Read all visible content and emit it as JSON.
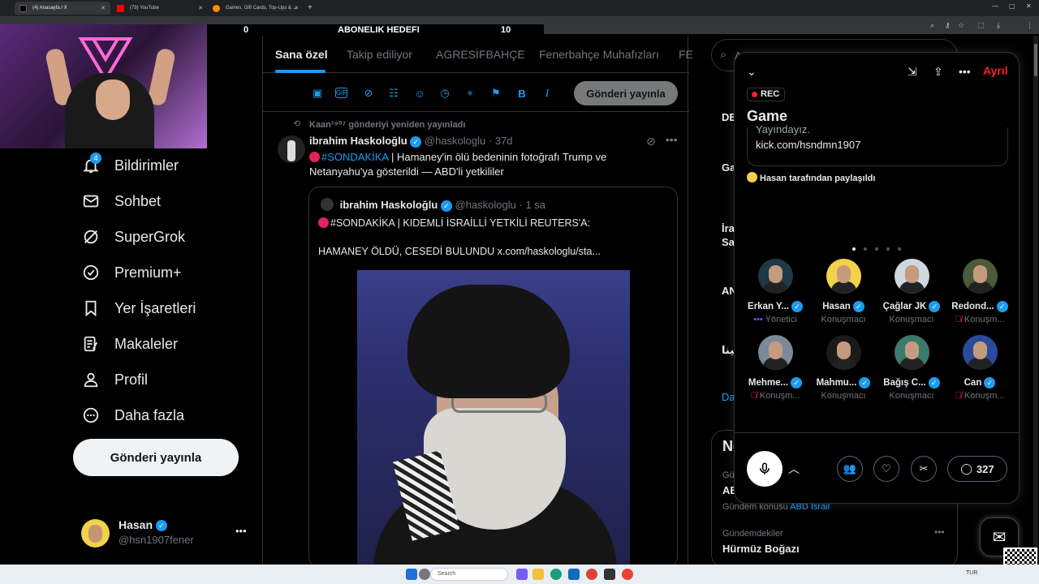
{
  "browser": {
    "tabs": [
      {
        "label": "(4) Anasayfa / X",
        "active": true
      },
      {
        "label": "(79) YouTube",
        "active": false
      },
      {
        "label": "Games, Gift Cards, Top-Ups & ...",
        "active": false
      }
    ]
  },
  "stream_overlay": {
    "left_value": "0",
    "goal_label": "ABONELIK HEDEFI",
    "right_value": "10"
  },
  "sidebar": {
    "items": [
      {
        "label": "Bildirimler",
        "icon": "bell-icon",
        "badge": "4"
      },
      {
        "label": "Sohbet",
        "icon": "mail-icon"
      },
      {
        "label": "SuperGrok",
        "icon": "grok-icon"
      },
      {
        "label": "Premium+",
        "icon": "verified-icon"
      },
      {
        "label": "Yer İşaretleri",
        "icon": "bookmark-icon"
      },
      {
        "label": "Makaleler",
        "icon": "article-icon"
      },
      {
        "label": "Profil",
        "icon": "person-icon"
      },
      {
        "label": "Daha fazla",
        "icon": "more-circle-icon"
      }
    ],
    "post_button": "Gönderi yayınla",
    "profile": {
      "name": "Hasan",
      "handle": "@hsn1907fener",
      "more": "•••"
    }
  },
  "feed": {
    "tabs": [
      "Sana özel",
      "Takip ediliyor",
      "AGRESİFBAHÇE",
      "Fenerbahçe Muhafızları",
      "FE"
    ],
    "composer_publish": "Gönderi yayınla",
    "repost_line": "Kaan¹⁹⁰⁷ gönderiyi yeniden yayınladı",
    "tweet": {
      "name": "ibrahim Haskoloğlu",
      "handle": "@haskologlu",
      "time": "· 37d",
      "hashtag": "#SONDAKİKA",
      "text": " | Hamaney'in ölü bedeninin fotoğrafı Trump ve Netanyahu'ya gösterildi — ABD'li yetkililer"
    },
    "quote": {
      "name": "ibrahim Haskoloğlu",
      "handle": "@haskologlu",
      "time": "· 1 sa",
      "line1": "#SONDAKİKA | KIDEMLİ İSRAİLLİ YETKİLİ REUTERS'A:",
      "line2": "HAMANEY ÖLDÜ, CESEDİ BULUNDU  x.com/haskologlu/sta..."
    }
  },
  "right_column": {
    "search_placeholder": "A",
    "snippets": [
      "DE",
      "Ga",
      "İra",
      "Sa",
      "AN",
      "مینا",
      "Da"
    ],
    "trends": {
      "heading": "Ne",
      "row1_label": "Gün",
      "row1_title": "AB",
      "row1_sub": "Gündem konusu",
      "row1_link": "ABD İsrail",
      "row2_label": "Gündemdekiler",
      "row2_title": "Hürmüz Boğazı"
    }
  },
  "space": {
    "leave": "Ayrıl",
    "rec": "REC",
    "title": "Game",
    "card_line1": "Yayındayız.",
    "card_line2": "kick.com/hsndmn1907",
    "shared_by": "Hasan tarafından paylaşıldı",
    "speakers": [
      {
        "name": "Erkan Y...",
        "role": "Yönetici",
        "mic": "host",
        "bg": "#1e3a46"
      },
      {
        "name": "Hasan",
        "role": "Konuşmacı",
        "mic": "on",
        "bg": "#f2d24a"
      },
      {
        "name": "Çağlar JK",
        "role": "Konuşmacı",
        "mic": "on",
        "bg": "#cfd7df"
      },
      {
        "name": "Redond...",
        "role": "Konuşm...",
        "mic": "muted",
        "bg": "#4a5a3a"
      },
      {
        "name": "Mehme...",
        "role": "Konuşm...",
        "mic": "muted",
        "bg": "#7a8a98"
      },
      {
        "name": "Mahmu...",
        "role": "Konuşmacı",
        "mic": "on",
        "bg": "#1a1a1a"
      },
      {
        "name": "Bağış C...",
        "role": "Konuşmacı",
        "mic": "on",
        "bg": "#3a7a6a"
      },
      {
        "name": "Can",
        "role": "Konuşm...",
        "mic": "muted",
        "bg": "#2a4a9a"
      }
    ],
    "listener_count": "327"
  },
  "taskbar": {
    "search": "Search",
    "lang": "TUR"
  }
}
